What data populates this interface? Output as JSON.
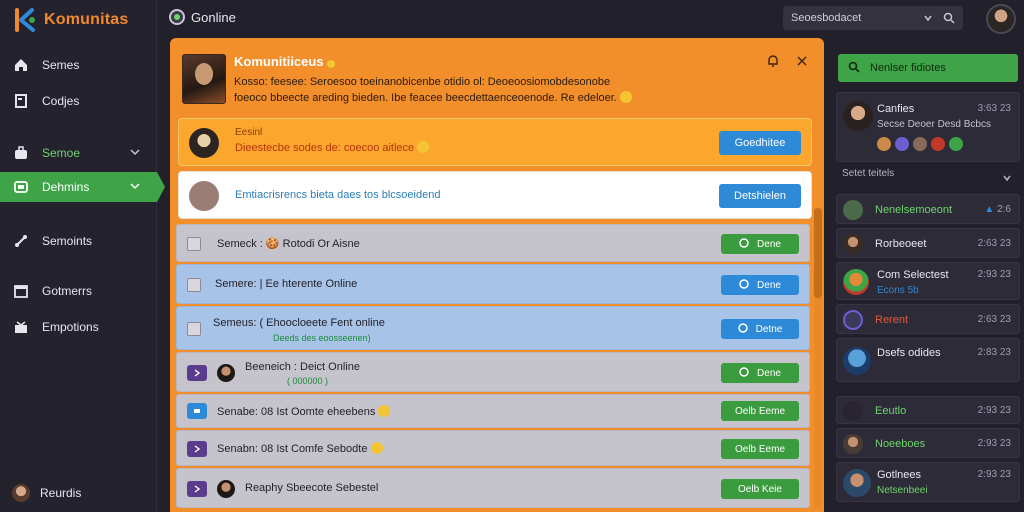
{
  "app": {
    "name": "Komunitas"
  },
  "topbar": {
    "title": "Gonline",
    "search_value": "Seoesbodacet"
  },
  "sidebar": {
    "items": [
      {
        "label": "Semes",
        "icon": "home-icon"
      },
      {
        "label": "Codjes",
        "icon": "document-icon"
      },
      {
        "label": "Semoe",
        "icon": "briefcase-icon"
      },
      {
        "label": "Dehmins",
        "icon": "community-icon"
      },
      {
        "label": "Semoints",
        "icon": "link-icon"
      },
      {
        "label": "Gotmerrs",
        "icon": "calendar-icon"
      },
      {
        "label": "Empotions",
        "icon": "gift-icon"
      }
    ],
    "footer_user": "Reurdis"
  },
  "panel": {
    "title": "Komunitiiceus",
    "desc_line1": "Kosso: feesee: Seroesoo toeinanobicenbe otidio ol: Deoeoosiomobdesonobe",
    "desc_line2": "foeoco bbeecte areding bieden. Ibe feacee beecdettaenceoenode. Re edeloer.",
    "banner_orange": {
      "label": "Eesinl",
      "text": "Dieestecbe sodes de: coecoo aitlece",
      "button": "Goedhitee"
    },
    "banner_white": {
      "text": "Emtiacrisrencs bieta daes tos blcsoeidend",
      "button": "Detshielen"
    },
    "rows": [
      {
        "text": "Semeck : 🍪 Rotodi Or Aisne",
        "sub": "",
        "button": "Dene"
      },
      {
        "text": "Semere: | Ee hterente Online",
        "sub": "",
        "button": "Dene"
      },
      {
        "text": "Semeus: ( Ehoocloeete Fent online",
        "sub": "Deeds des eoosseenen)",
        "button": "Detne"
      },
      {
        "text": "Beeneich : Deict Online",
        "sub": "( 000000 )",
        "button": "Dene"
      },
      {
        "text": "Senabe: 08 Ist Oomte eheebens",
        "sub": "",
        "button": "Oelb Eeme"
      },
      {
        "text": "Senabn: 08 Ist Comfe Sebodte",
        "sub": "",
        "button": "Oelb Eeme"
      },
      {
        "text": "Reaphy  Sbeecote Sebestel",
        "sub": "",
        "button": "Oelb Keie"
      }
    ]
  },
  "right": {
    "search_label": "Nenlser fidiotes",
    "top_card": {
      "name": "Canfies",
      "time": "3:63 23",
      "sub": "Secse Deoer Desd Bcbcs"
    },
    "section": "Setet teitels",
    "cards": [
      {
        "name": "Nenelsemoeont",
        "time": "2:6"
      },
      {
        "name": "Rorbeoeet",
        "time": "2:63 23"
      },
      {
        "name": "Com Selectest",
        "time": "2:93 23",
        "sub": "Econs 5b"
      },
      {
        "name": "Rerent",
        "time": "2:63 23"
      },
      {
        "name": "Dsefs odides",
        "time": "2:83 23"
      },
      {
        "name": "Eeutlo",
        "time": "2:93 23"
      },
      {
        "name": "Noeeboes",
        "time": "2:93 23"
      },
      {
        "name": "Gotlnees",
        "time": "2:93 23",
        "sub": "Netsenbeei"
      }
    ]
  }
}
